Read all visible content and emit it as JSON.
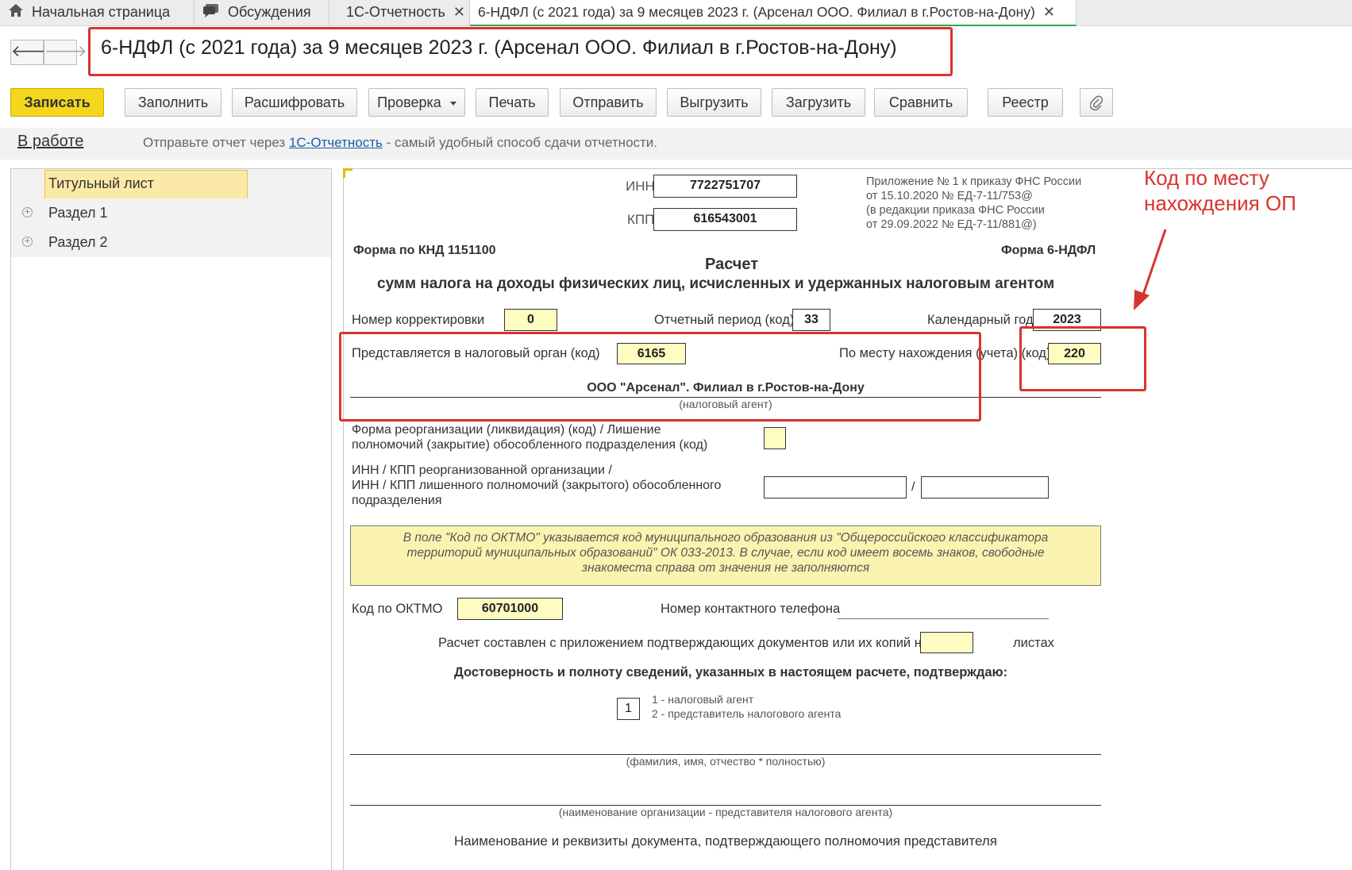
{
  "tabs": [
    {
      "label": "Начальная страница"
    },
    {
      "label": "Обсуждения"
    },
    {
      "label": "1С-Отчетность"
    },
    {
      "label": "6-НДФЛ (с 2021 года) за 9 месяцев 2023 г. (Арсенал ООО. Филиал в г.Ростов-на-Дону)"
    }
  ],
  "close_glyph": "✕",
  "nav": {
    "back": "🡐",
    "forward": "🡒"
  },
  "title": "6-НДФЛ (с 2021 года) за 9 месяцев 2023 г. (Арсенал ООО. Филиал в г.Ростов-на-Дону)",
  "toolbar": {
    "save": "Записать",
    "fill": "Заполнить",
    "decode": "Расшифровать",
    "check": "Проверка",
    "print": "Печать",
    "send": "Отправить",
    "export": "Выгрузить",
    "import": "Загрузить",
    "compare": "Сравнить",
    "registry": "Реестр"
  },
  "status": {
    "state": "В работе",
    "msg_before": "Отправьте отчет через ",
    "msg_link": "1С-Отчетность",
    "msg_after": " - самый удобный способ сдачи отчетности."
  },
  "tree": [
    {
      "label": "Титульный лист"
    },
    {
      "label": "Раздел 1"
    },
    {
      "label": "Раздел 2"
    }
  ],
  "form": {
    "inn_label": "ИНН",
    "inn": "7722751707",
    "kpp_label": "КПП",
    "kpp": "616543001",
    "appendix": [
      "Приложение № 1 к приказу ФНС России",
      "от 15.10.2020 № ЕД-7-11/753@",
      "(в редакции приказа ФНС России",
      "от 29.09.2022 № ЕД-7-11/881@)"
    ],
    "knd": "Форма по КНД 1151100",
    "form_name": "Форма 6-НДФЛ",
    "heading1": "Расчет",
    "heading2": "сумм налога на доходы физических лиц, исчисленных и удержанных налоговым агентом",
    "correction_label": "Номер корректировки",
    "correction": "0",
    "period_label": "Отчетный период (код)",
    "period": "33",
    "year_label": "Календарный год",
    "year": "2023",
    "tax_authority_label": "Представляется в налоговый орган (код)",
    "tax_authority": "6165",
    "location_label": "По месту нахождения (учета) (код)",
    "location": "220",
    "agent_name": "ООО \"Арсенал\". Филиал в г.Ростов-на-Дону",
    "agent_caption": "(налоговый агент)",
    "reorg_label_1": "Форма реорганизации (ликвидация) (код) / Лишение",
    "reorg_label_2": "полномочий (закрытие) обособленного подразделения (код)",
    "reorg_inn_label_1": "ИНН / КПП реорганизованной организации /",
    "reorg_inn_label_2": "ИНН / КПП лишенного полномочий (закрытого) обособленного",
    "reorg_inn_label_3": "подразделения",
    "slash": "/",
    "note": "В поле \"Код по ОКТМО\" указывается код муниципального образования из \"Общероссийского классификатора территорий муниципальных образований\" ОК 033-2013. В случае, если код имеет восемь знаков, свободные знакоместа справа от значения не заполняются",
    "oktmo_label": "Код по ОКТМО",
    "oktmo": "60701000",
    "phone_label": "Номер контактного телефона",
    "pages_label": "Расчет составлен с приложением подтверждающих документов или их копий на",
    "pages_suffix": "листах",
    "confirm_heading": "Достоверность и полноту сведений, указанных в настоящем расчете, подтверждаю:",
    "signer": "1",
    "signer_opt1": "1 - налоговый агент",
    "signer_opt2": "2 - представитель налогового агента",
    "fio_caption": "(фамилия, имя, отчество * полностью)",
    "org_caption": "(наименование организации - представителя налогового агента)",
    "doc_caption": "Наименование и реквизиты документа, подтверждающего полномочия представителя"
  },
  "annotation": {
    "line1": "Код по месту",
    "line2": "нахождения ОП",
    "color": "#d9332f"
  }
}
